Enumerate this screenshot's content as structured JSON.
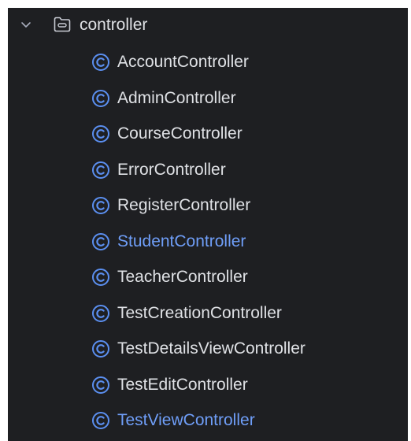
{
  "tree": {
    "folder": {
      "label": "controller",
      "expanded": true,
      "icon": "folder-icon"
    },
    "items": [
      {
        "label": "AccountController",
        "icon": "class-icon",
        "status": "normal"
      },
      {
        "label": "AdminController",
        "icon": "class-icon",
        "status": "normal"
      },
      {
        "label": "CourseController",
        "icon": "class-icon",
        "status": "normal"
      },
      {
        "label": "ErrorController",
        "icon": "class-icon",
        "status": "normal"
      },
      {
        "label": "RegisterController",
        "icon": "class-icon",
        "status": "normal"
      },
      {
        "label": "StudentController",
        "icon": "class-icon",
        "status": "modified"
      },
      {
        "label": "TeacherController",
        "icon": "class-icon",
        "status": "normal"
      },
      {
        "label": "TestCreationController",
        "icon": "class-icon",
        "status": "normal"
      },
      {
        "label": "TestDetailsViewController",
        "icon": "class-icon",
        "status": "normal"
      },
      {
        "label": "TestEditController",
        "icon": "class-icon",
        "status": "normal"
      },
      {
        "label": "TestViewController",
        "icon": "class-icon",
        "status": "modified"
      }
    ]
  },
  "colors": {
    "background": "#1e1f22",
    "text_normal": "#dfe1e5",
    "text_modified": "#6f9ef8",
    "class_icon": "#5b8ff0"
  }
}
